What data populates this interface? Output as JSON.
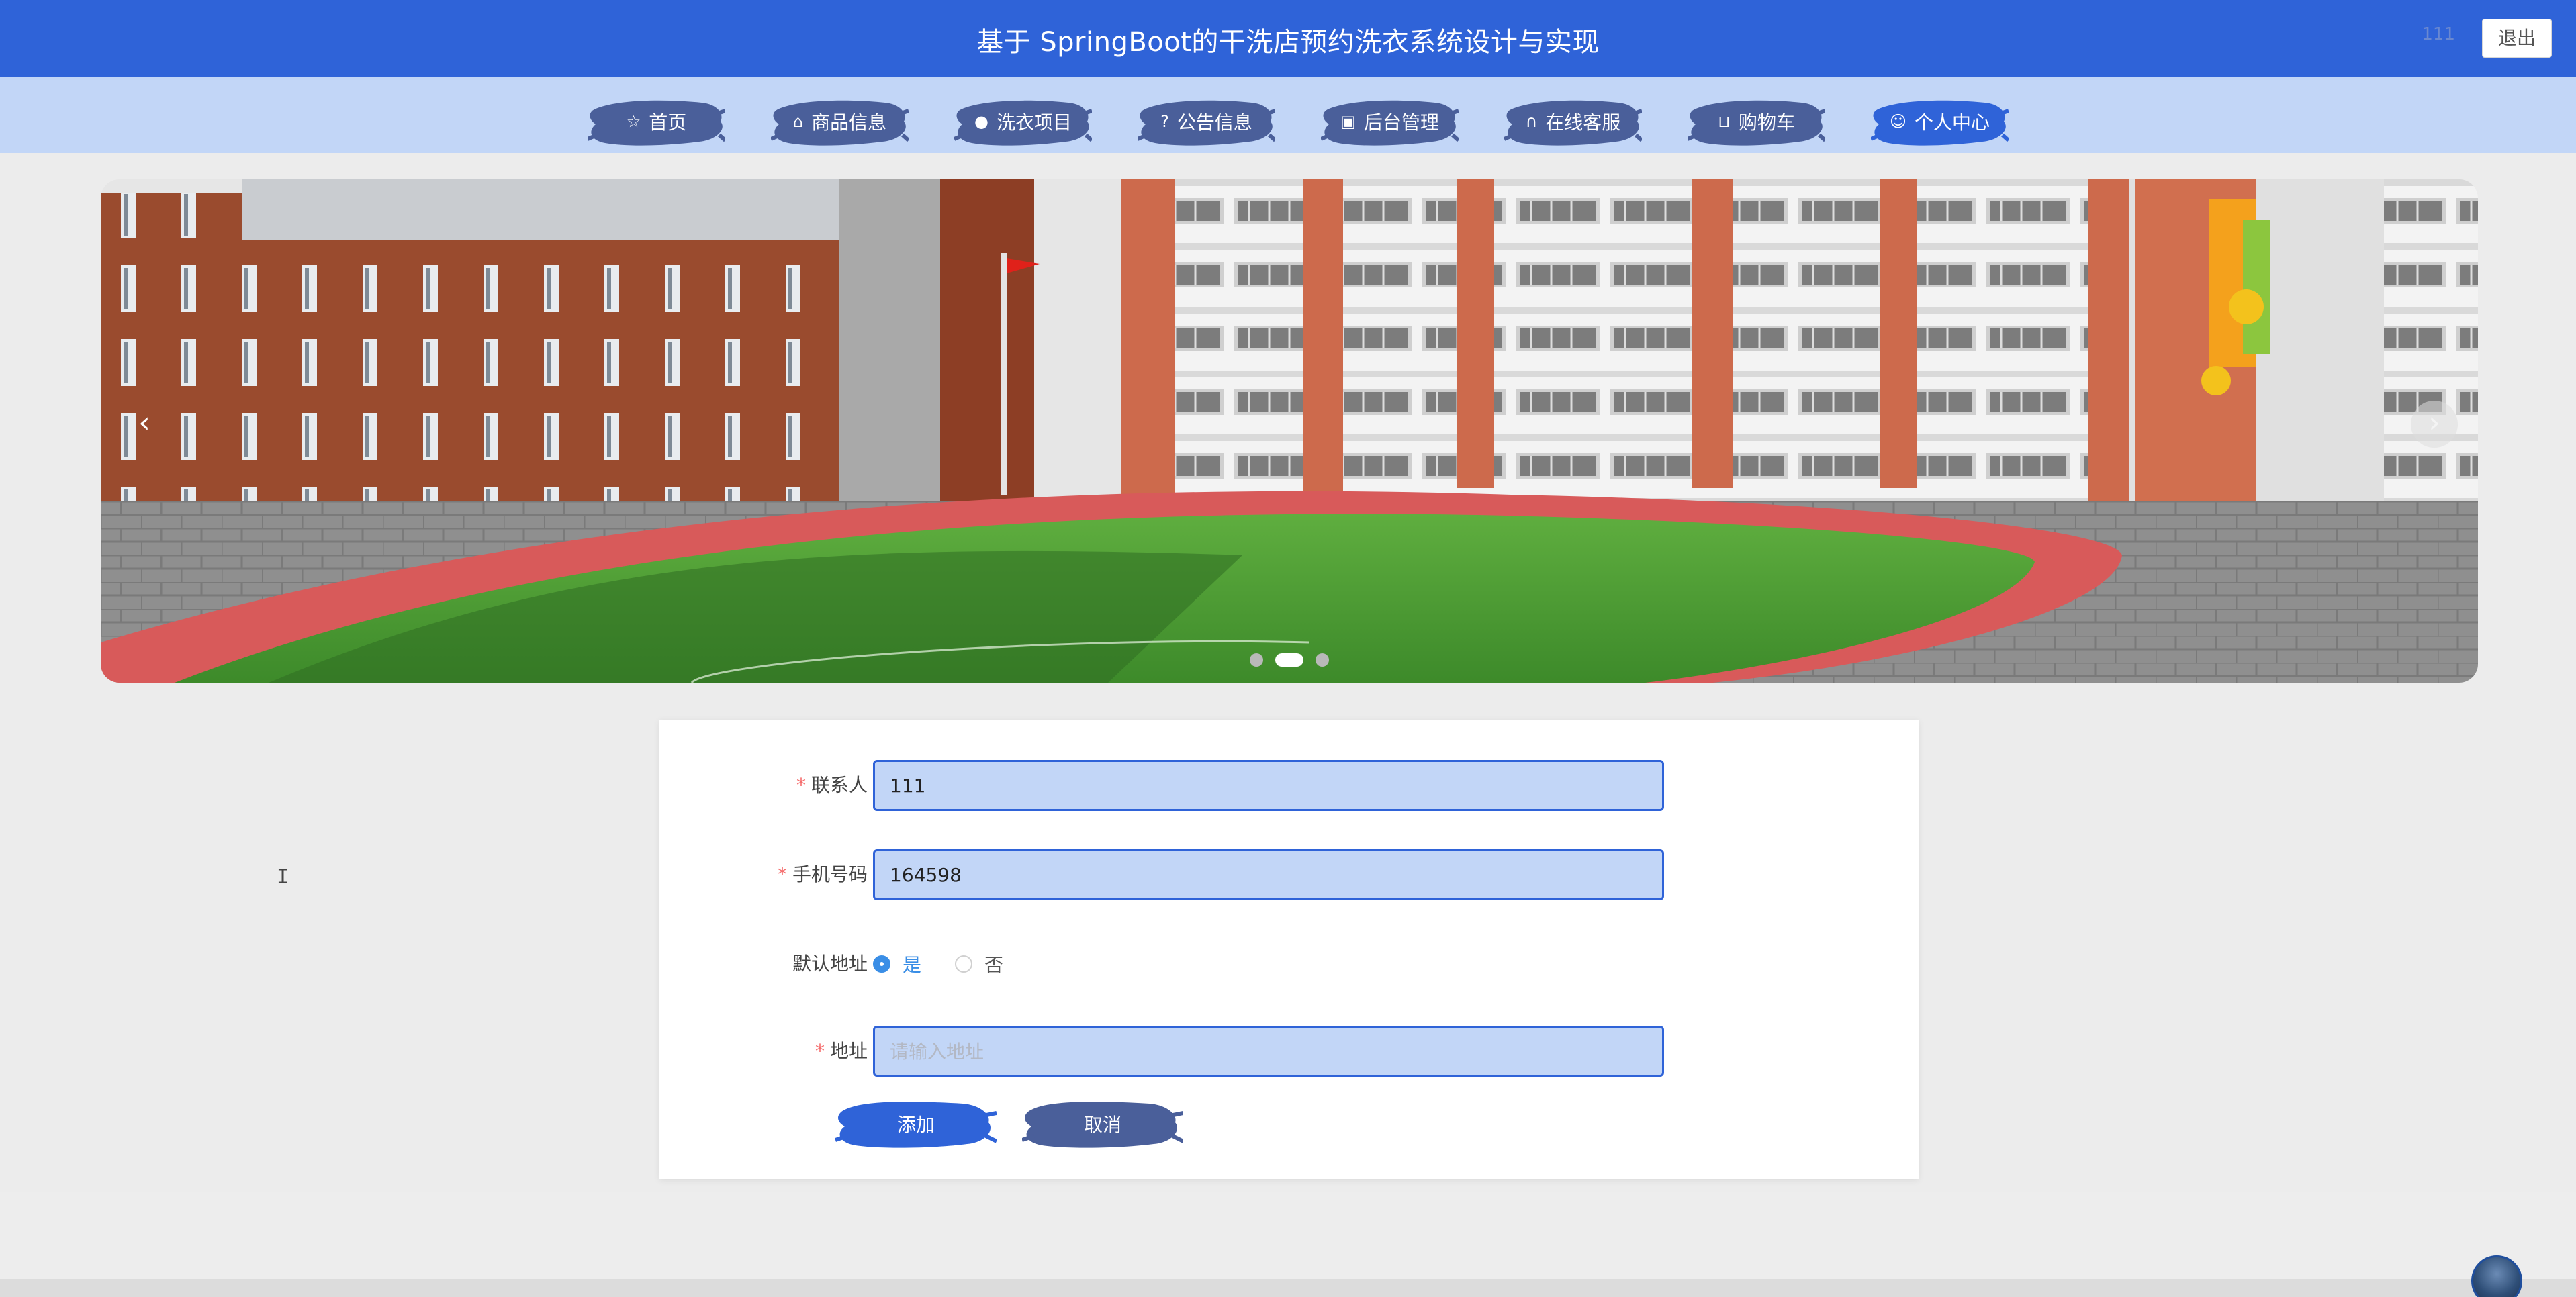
{
  "header": {
    "title": "基于 SpringBoot的干洗店预约洗衣系统设计与实现",
    "user_hint": "111",
    "logout_label": "退出"
  },
  "nav": {
    "items": [
      {
        "label": "首页",
        "icon": "star-icon"
      },
      {
        "label": "商品信息",
        "icon": "bag-icon"
      },
      {
        "label": "洗衣项目",
        "icon": "info-icon"
      },
      {
        "label": "公告信息",
        "icon": "question-icon"
      },
      {
        "label": "后台管理",
        "icon": "gift-icon"
      },
      {
        "label": "在线客服",
        "icon": "headset-icon"
      },
      {
        "label": "购物车",
        "icon": "cart-icon"
      },
      {
        "label": "个人中心",
        "icon": "user-icon"
      }
    ],
    "active_index": 7
  },
  "carousel": {
    "prev_glyph": "‹",
    "next_glyph": "›",
    "slide_count": 3,
    "active_slide": 2
  },
  "form": {
    "contact": {
      "label": "联系人",
      "value": "111",
      "required": true
    },
    "phone": {
      "label": "手机号码",
      "value": "164598",
      "required": true
    },
    "default_address": {
      "label": "默认地址",
      "options": [
        "是",
        "否"
      ],
      "selected": "是"
    },
    "address": {
      "label": "地址",
      "value": "",
      "placeholder": "请输入地址",
      "required": true
    },
    "submit_label": "添加",
    "cancel_label": "取消"
  },
  "colors": {
    "primary": "#2f63d8",
    "nav_bg": "#c2d6f7",
    "brush_blue": "#2f63d8",
    "brush_slate": "#4a5f9a",
    "radio_checked": "#3a8ee6",
    "required_star": "#f56c6c"
  }
}
